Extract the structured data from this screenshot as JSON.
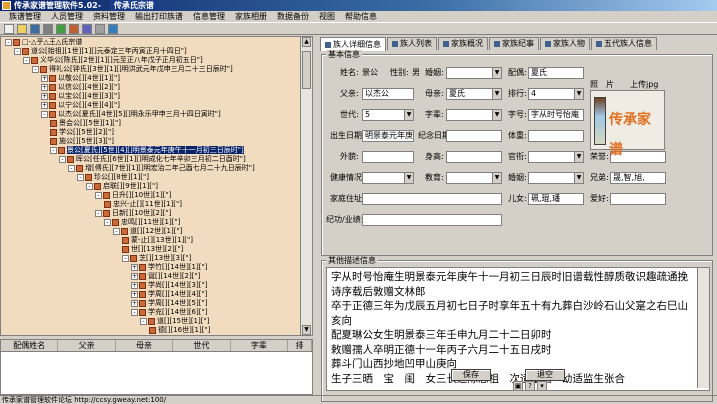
{
  "window": {
    "title": "传承家谱管理软件5.02-",
    "logo_text": "传承氏宗谱"
  },
  "menu": [
    "族谱管理",
    "人员管理",
    "资料管理",
    "输出打印族谱",
    "信息管理",
    "家族相册",
    "数据备份",
    "视图",
    "帮助信息"
  ],
  "toolbar_buttons": [
    "new-file-icon",
    "open-file-icon",
    "save-icon",
    "print-icon",
    "refresh-icon",
    "photo-icon",
    "tree-icon",
    "settings-icon",
    "help-icon"
  ],
  "tree": [
    {
      "depth": 0,
      "label": "□-△乎△王△氏宗谱",
      "exp": "-"
    },
    {
      "depth": 1,
      "label": "道公[始祖][1世][1][]元泰定三年丙寅正月十四日\"]",
      "exp": "-"
    },
    {
      "depth": 2,
      "label": "义华公[陈氏][2世][1][]元至正八年戊子正月初五日\"]",
      "exp": "-"
    },
    {
      "depth": 3,
      "label": "得礼公[钟氏][3世][1][]明洪武元年戊申三月二十三日辰时\"]",
      "exp": "-"
    },
    {
      "depth": 4,
      "label": "以敬公[][4世][1][\"]",
      "exp": "+"
    },
    {
      "depth": 4,
      "label": "以信公[][4世][2][\"]",
      "exp": "+"
    },
    {
      "depth": 4,
      "label": "以宝公[][4世][3][\"]",
      "exp": "+"
    },
    {
      "depth": 4,
      "label": "以宁公[][4世][4][\"]",
      "exp": "+"
    },
    {
      "depth": 4,
      "label": "以杰公[夏氏][4世][5][]明永乐甲申三月十四日寅时\"]",
      "exp": "-"
    },
    {
      "depth": 5,
      "label": "景会公[][5世][1][\"]",
      "exp": ""
    },
    {
      "depth": 5,
      "label": "学公[][5世][2][\"]",
      "exp": ""
    },
    {
      "depth": 5,
      "label": "施公[][5世][3][\"]",
      "exp": ""
    },
    {
      "depth": 5,
      "label": "景公[夏氏][5世][4][]明景泰元年庚午十一月初三日辰时\"]",
      "exp": "-",
      "selected": true
    },
    {
      "depth": 6,
      "label": "晖公[任氏][6世][1][]明成化七年辛卯三月初二日酉时\"]",
      "exp": "-"
    },
    {
      "depth": 7,
      "label": "增[傅氏][7世][1][]明宏治二年己酉七月二十九日辰时\"]",
      "exp": "-"
    },
    {
      "depth": 8,
      "label": "珍公[][8世][1][\"]",
      "exp": "-"
    },
    {
      "depth": 9,
      "label": "启联[][9世][1][\"]",
      "exp": "-"
    },
    {
      "depth": 10,
      "label": "日升[][10世][1][\"]",
      "exp": "-"
    },
    {
      "depth": 11,
      "label": "忠兴-止[][11世][1][\"]",
      "exp": ""
    },
    {
      "depth": 10,
      "label": "日新[][10世][2][\"]",
      "exp": "-"
    },
    {
      "depth": 11,
      "label": "忠鸣[][11世][1][\"]",
      "exp": "-"
    },
    {
      "depth": 12,
      "label": "道[][12世][1][\"]",
      "exp": "-"
    },
    {
      "depth": 13,
      "label": "蒙-止[][13世][1][\"]",
      "exp": ""
    },
    {
      "depth": 13,
      "label": "世[][13世][2][\"]",
      "exp": ""
    },
    {
      "depth": 13,
      "label": "芝[][13世][3][\"]",
      "exp": "-"
    },
    {
      "depth": 14,
      "label": "学竹[][14世][1][\"]",
      "exp": "+"
    },
    {
      "depth": 14,
      "label": "诞[][14世][2][\"]",
      "exp": "+"
    },
    {
      "depth": 14,
      "label": "学尚[][14世][3][\"]",
      "exp": "+"
    },
    {
      "depth": 14,
      "label": "学周[][14世][4][\"]",
      "exp": "+"
    },
    {
      "depth": 14,
      "label": "学周[][14世][5][\"]",
      "exp": "+"
    },
    {
      "depth": 14,
      "label": "学充[][14世][6][\"]",
      "exp": "-"
    },
    {
      "depth": 15,
      "label": "道[][15世][1][\"]",
      "exp": "-"
    },
    {
      "depth": 16,
      "label": "德[][16世][1][\"]",
      "exp": ""
    }
  ],
  "spouse_grid": {
    "headers": [
      "配偶姓名",
      "父亲",
      "母亲",
      "世代",
      "字辈",
      "排"
    ]
  },
  "tabs": [
    "族人详细信息",
    "族人列表",
    "家族概况",
    "家族纪事",
    "家族人物",
    "五代族人信息"
  ],
  "basic": {
    "legend": "基本信息",
    "name_label": "姓名:",
    "name_value": "景公",
    "gender_label": "性别:",
    "gender_value": "男",
    "spouse_label": "婚姻:",
    "spouse_value": "",
    "wife_label": "配偶:",
    "wife_value": "夏氏",
    "father_label": "父亲:",
    "father_value": "以杰公",
    "mother_label": "母亲:",
    "mother_value": "夏氏",
    "rank_label": "排行:",
    "rank_value": "4",
    "gen_label": "世代:",
    "gen_value": "5",
    "zibei_label": "字辈:",
    "zibei_value": "",
    "zihao_label": "字号:",
    "zihao_value": "字从时号怡庵",
    "birth_label": "出生日期:",
    "birth_value": "明景泰元年庚午",
    "memorial_label": "纪念日期:",
    "memorial_value": "",
    "remark_label": "体重:",
    "remark_value": "",
    "waimao_label": "外貌:",
    "waimao_value": "",
    "height_label": "身高:",
    "height_value": "",
    "official_label": "官衔:",
    "official_value": "",
    "honor_label": "荣誉:",
    "honor_value": "",
    "health_label": "健康情况:",
    "health_value": "",
    "edu_label": "教育:",
    "edu_value": "",
    "marriage_label": "婚姻:",
    "marriage_value": "",
    "siblings_label": "兄弟:",
    "siblings_value": "晟,智,旭,",
    "address_label": "家庭住址:",
    "address_value": "",
    "children_label": "儿女:",
    "children_value": "珮,琨,璠",
    "hobby_label": "爱好:",
    "hobby_value": "",
    "deeds_label": "纪功/业绩:",
    "deeds_value": "",
    "photo_label": "照　片",
    "upload_label": "上传jpg",
    "photo_logo": "传承家谱"
  },
  "other": {
    "legend": "其他描述信息",
    "memo_lines": [
      "字从时号怡庵生明景泰元年庚午十一月初三日辰时旧谱载性醇质敬识趣疏通挽",
      "诗序载后敦赠文林郎",
      "卒于正德三年为戊辰五月初七日子时享年五十有九葬白沙岭石山父寔之右巳山",
      "亥向",
      "配夏琳公女生明景泰三年壬申九月二十二日卯时",
      "敕赠孺人卒明正德十一年丙子六月二十五日戌时",
      "葬斗门山西抄地凹甲山庚向",
      "生子三晒　宝　闺　女三长适陈思祖　次适董相　幼适监生张合"
    ]
  },
  "buttons": {
    "save": "保存",
    "close": "退空"
  },
  "status": {
    "text": "传承家谱管理软件论坛  http://ccsy.gweay.net:100/"
  }
}
